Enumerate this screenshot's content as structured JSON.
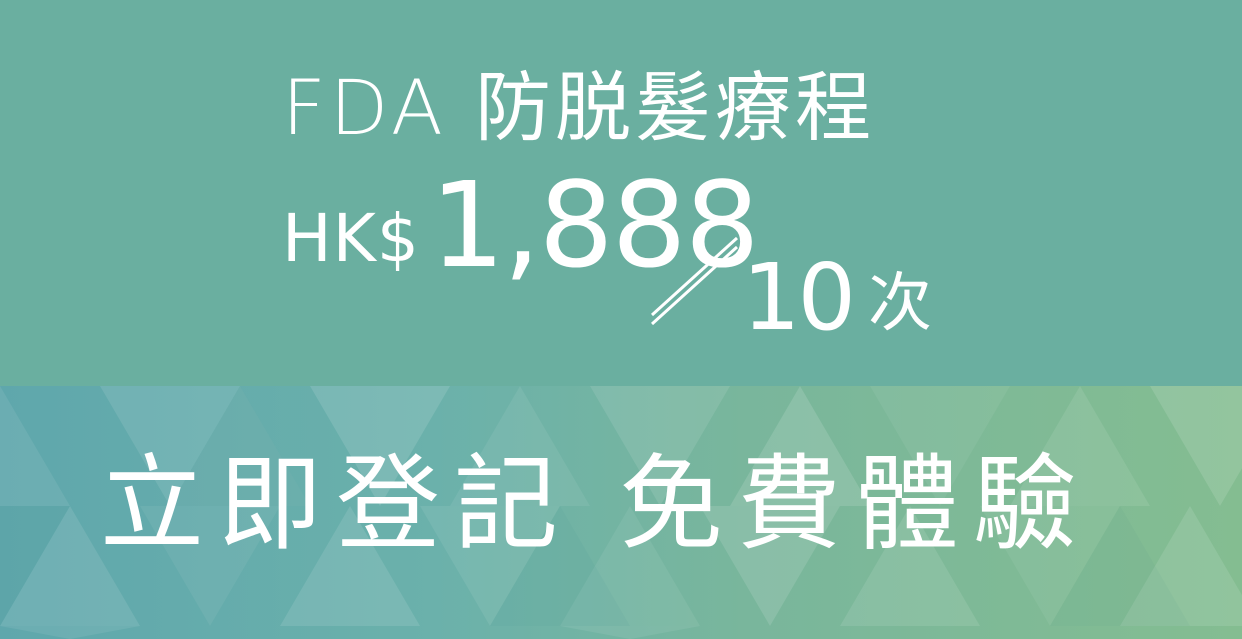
{
  "promo": {
    "title": "FDA 防脱髮療程",
    "currency": "HK$",
    "amount": "1,888",
    "count": "10",
    "unit": "次"
  },
  "cta": {
    "text": "立即登記 免費體驗"
  },
  "colors": {
    "top_background": "#6aafa0",
    "pattern_left": "#5fa7ac",
    "pattern_right": "#84bd91",
    "text": "#ffffff"
  }
}
